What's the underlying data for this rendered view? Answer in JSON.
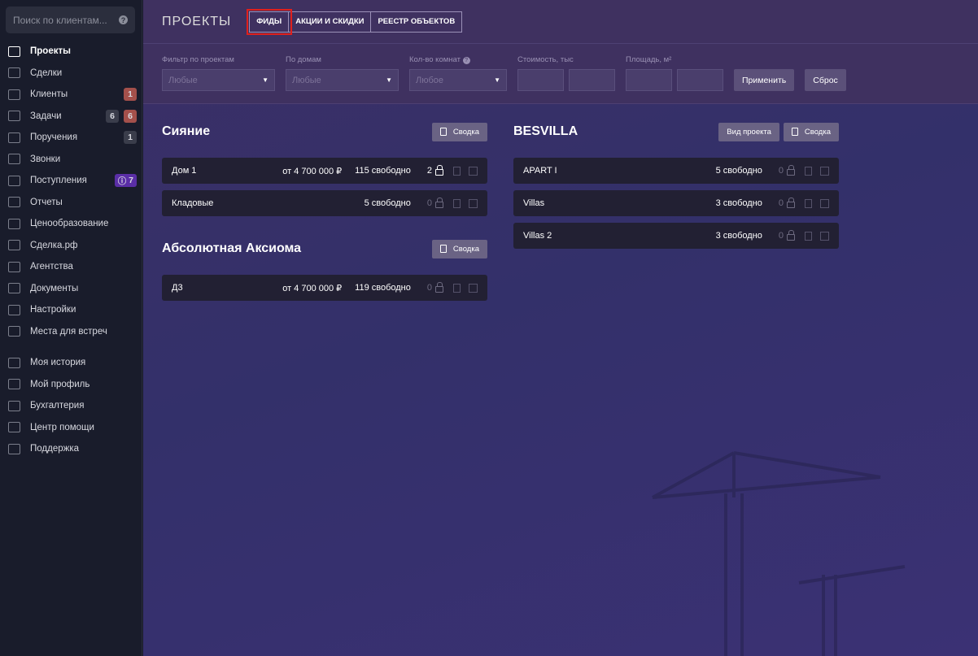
{
  "sidebar": {
    "search_placeholder": "Поиск по клиентам...",
    "items": [
      {
        "label": "Проекты"
      },
      {
        "label": "Сделки"
      },
      {
        "label": "Клиенты",
        "badges": [
          "1"
        ]
      },
      {
        "label": "Задачи",
        "badges": [
          "6",
          "6"
        ]
      },
      {
        "label": "Поручения",
        "badges": [
          "1"
        ]
      },
      {
        "label": "Звонки"
      },
      {
        "label": "Поступления",
        "badges": [
          "7"
        ]
      },
      {
        "label": "Отчеты"
      },
      {
        "label": "Ценообразование"
      },
      {
        "label": "Сделка.рф"
      },
      {
        "label": "Агентства"
      },
      {
        "label": "Документы"
      },
      {
        "label": "Настройки"
      },
      {
        "label": "Места для встреч"
      },
      {
        "label": "Моя история"
      },
      {
        "label": "Мой профиль"
      },
      {
        "label": "Бухгалтерия"
      },
      {
        "label": "Центр помощи"
      },
      {
        "label": "Поддержка"
      }
    ]
  },
  "header": {
    "title": "ПРОЕКТЫ",
    "tabs": [
      "ФИДЫ",
      "АКЦИИ И СКИДКИ",
      "РЕЕСТР ОБЪЕКТОВ"
    ]
  },
  "filters": {
    "project_label": "Фильтр по проектам",
    "project_value": "Любые",
    "house_label": "По домам",
    "house_value": "Любые",
    "rooms_label": "Кол-во комнат",
    "rooms_value": "Любое",
    "price_label": "Стоимость, тыс",
    "area_label": "Площадь, м²",
    "apply": "Применить",
    "reset": "Сброс"
  },
  "summary_label": "Сводка",
  "view_project_label": "Вид проекта",
  "projects": [
    {
      "name": "Сияние",
      "rows": [
        {
          "name": "Дом 1",
          "price": "от 4 700 000 ₽",
          "free": "115 свободно",
          "locked": "2"
        },
        {
          "name": "Кладовые",
          "price": "",
          "free": "5 свободно",
          "locked": "0"
        }
      ]
    },
    {
      "name": "Абсолютная Аксиома",
      "rows": [
        {
          "name": "Д3",
          "price": "от 4 700 000 ₽",
          "free": "119 свободно",
          "locked": "0"
        }
      ]
    },
    {
      "name": "BESVILLA",
      "rows": [
        {
          "name": "APART I",
          "price": "",
          "free": "5 свободно",
          "locked": "0"
        },
        {
          "name": "Villas",
          "price": "",
          "free": "3 свободно",
          "locked": "0"
        },
        {
          "name": "Villas 2",
          "price": "",
          "free": "3 свободно",
          "locked": "0"
        }
      ]
    }
  ]
}
